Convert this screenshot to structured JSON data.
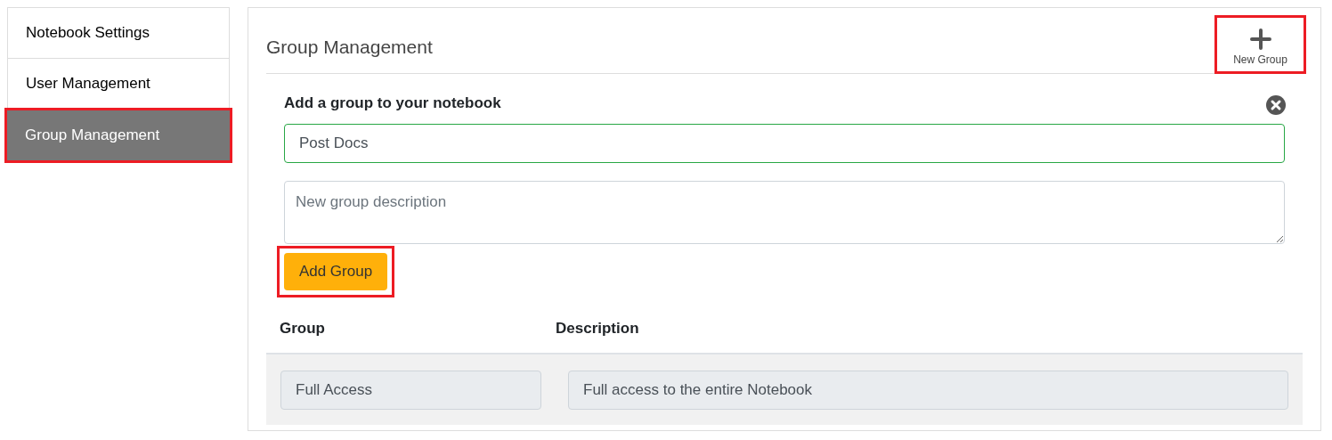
{
  "sidebar": {
    "items": [
      {
        "label": "Notebook Settings",
        "selected": false,
        "highlighted": false
      },
      {
        "label": "User Management",
        "selected": false,
        "highlighted": false
      },
      {
        "label": "Group Management",
        "selected": true,
        "highlighted": true
      }
    ]
  },
  "panel": {
    "title": "Group Management",
    "new_group_button": {
      "label": "New Group",
      "highlighted": true
    },
    "form": {
      "heading": "Add a group to your notebook",
      "name_field": {
        "value": "Post Docs"
      },
      "description_field": {
        "placeholder": "New group description"
      },
      "add_button": {
        "label": "Add Group",
        "highlighted": true
      }
    },
    "table": {
      "columns": [
        "Group",
        "Description"
      ],
      "rows": [
        {
          "group": "Full Access",
          "description": "Full access to the entire Notebook"
        }
      ]
    }
  }
}
